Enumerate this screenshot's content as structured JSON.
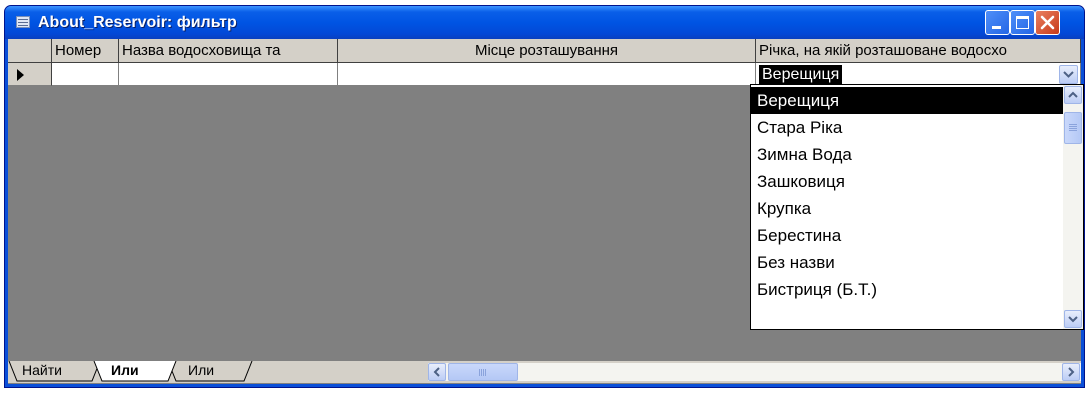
{
  "window": {
    "title": "About_Reservoir: фильтр",
    "controls": [
      "minimize",
      "maximize",
      "close"
    ]
  },
  "grid": {
    "columns": [
      "Номер",
      "Назва водосховища та",
      "Місце розташування",
      "Річка, на якій розташоване водосхо"
    ],
    "current_row_marker": "record-selector-arrow-icon",
    "filter_value": "Верещиця"
  },
  "dropdown": {
    "items": [
      "Верещиця",
      "Стара Ріка",
      "Зимна Вода",
      "Зашковиця",
      "Крупка",
      "Берестина",
      "Без назви",
      "Бистриця (Б.Т.)"
    ],
    "selected_index": 0
  },
  "tabs": [
    {
      "label": "Найти",
      "active": false
    },
    {
      "label": "Или",
      "active": true
    },
    {
      "label": "Или",
      "active": false
    }
  ],
  "colors": {
    "titlebar": "#0054e3",
    "workspace": "#808080",
    "face": "#d4d0c8",
    "selection": "#000000",
    "close_button": "#c73a19"
  }
}
